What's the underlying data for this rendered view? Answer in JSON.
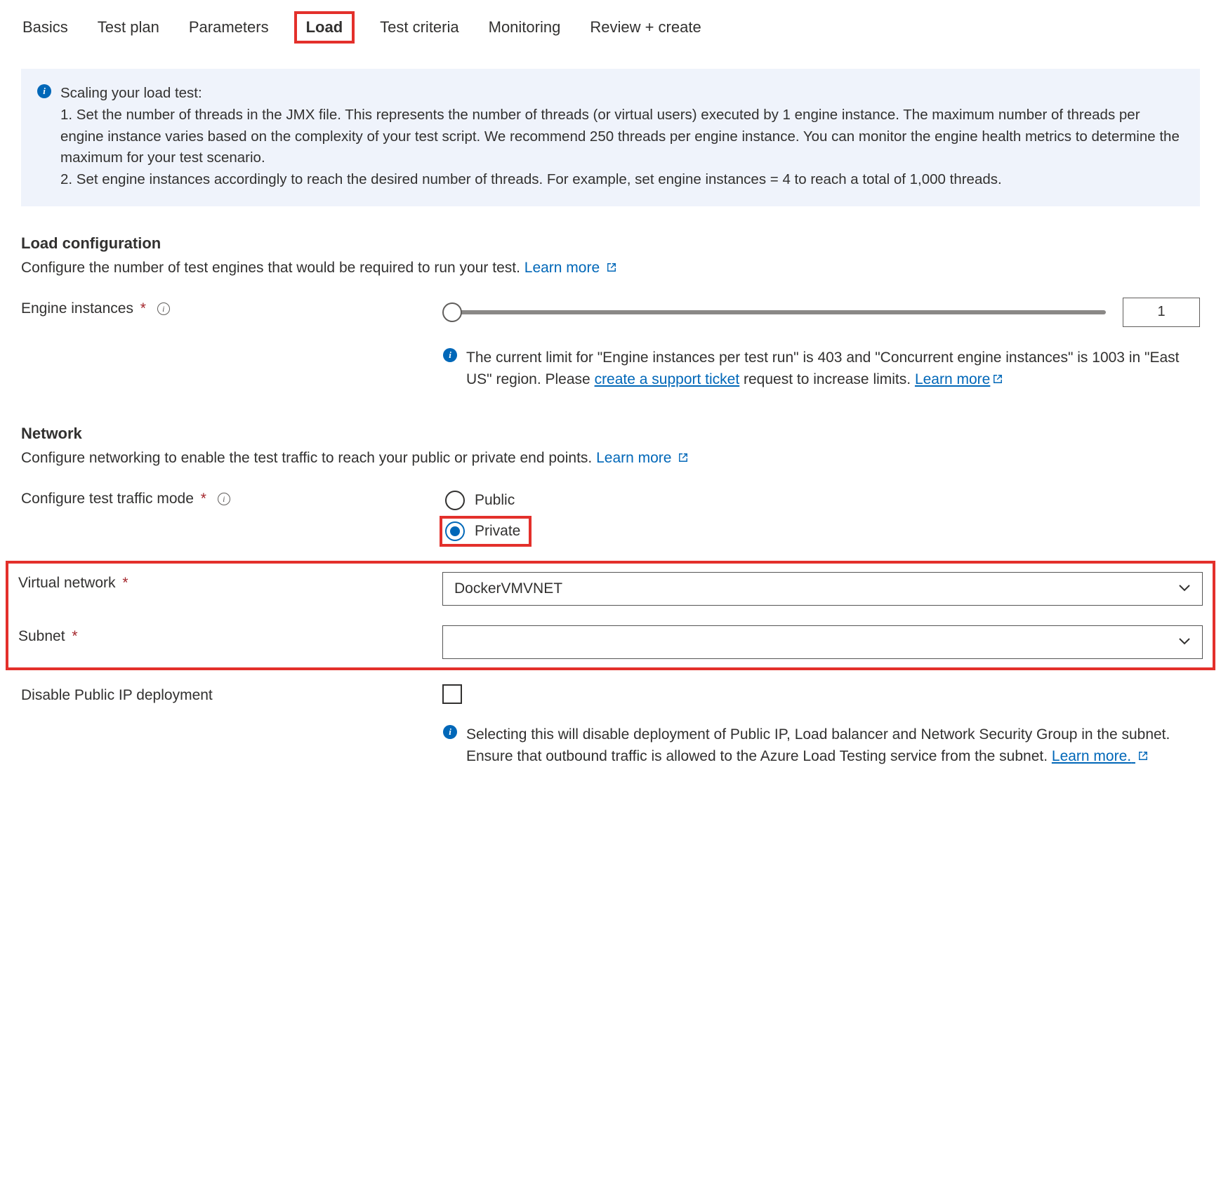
{
  "tabs": {
    "basics": "Basics",
    "test_plan": "Test plan",
    "parameters": "Parameters",
    "load": "Load",
    "test_criteria": "Test criteria",
    "monitoring": "Monitoring",
    "review": "Review + create"
  },
  "info": {
    "title": "Scaling your load test:",
    "line1": "1. Set the number of threads in the JMX file. This represents the number of threads (or virtual users) executed by 1 engine instance. The maximum number of threads per engine instance varies based on the complexity of your test script. We recommend 250 threads per engine instance. You can monitor the engine health metrics to determine the maximum for your test scenario.",
    "line2": "2. Set engine instances accordingly to reach the desired number of threads. For example, set engine instances = 4 to reach a total of 1,000 threads."
  },
  "load_cfg": {
    "title": "Load configuration",
    "subtitle": "Configure the number of test engines that would be required to run your test. ",
    "learn_more": "Learn more",
    "engine_instances_label": "Engine instances",
    "engine_value": "1",
    "limit_text_a": "The current limit for \"Engine instances per test run\" is 403 and \"Concurrent engine instances\" is 1003 in \"East US\" region. Please ",
    "limit_link": "create a support ticket",
    "limit_text_b": " request to increase limits. ",
    "limit_learn_more": "Learn more"
  },
  "network": {
    "title": "Network",
    "subtitle": "Configure networking to enable the test traffic to reach your public or private end points. ",
    "learn_more": "Learn more",
    "traffic_mode_label": "Configure test traffic mode",
    "public": "Public",
    "private": "Private",
    "vnet_label": "Virtual network",
    "vnet_value": "DockerVMVNET",
    "subnet_label": "Subnet",
    "subnet_value": "",
    "disable_ip_label": "Disable Public IP deployment",
    "disable_ip_info": "Selecting this will disable deployment of Public IP, Load balancer and Network Security Group in the subnet. Ensure that outbound traffic is allowed to the Azure Load Testing service from the subnet. ",
    "disable_ip_learn_more": "Learn more."
  }
}
